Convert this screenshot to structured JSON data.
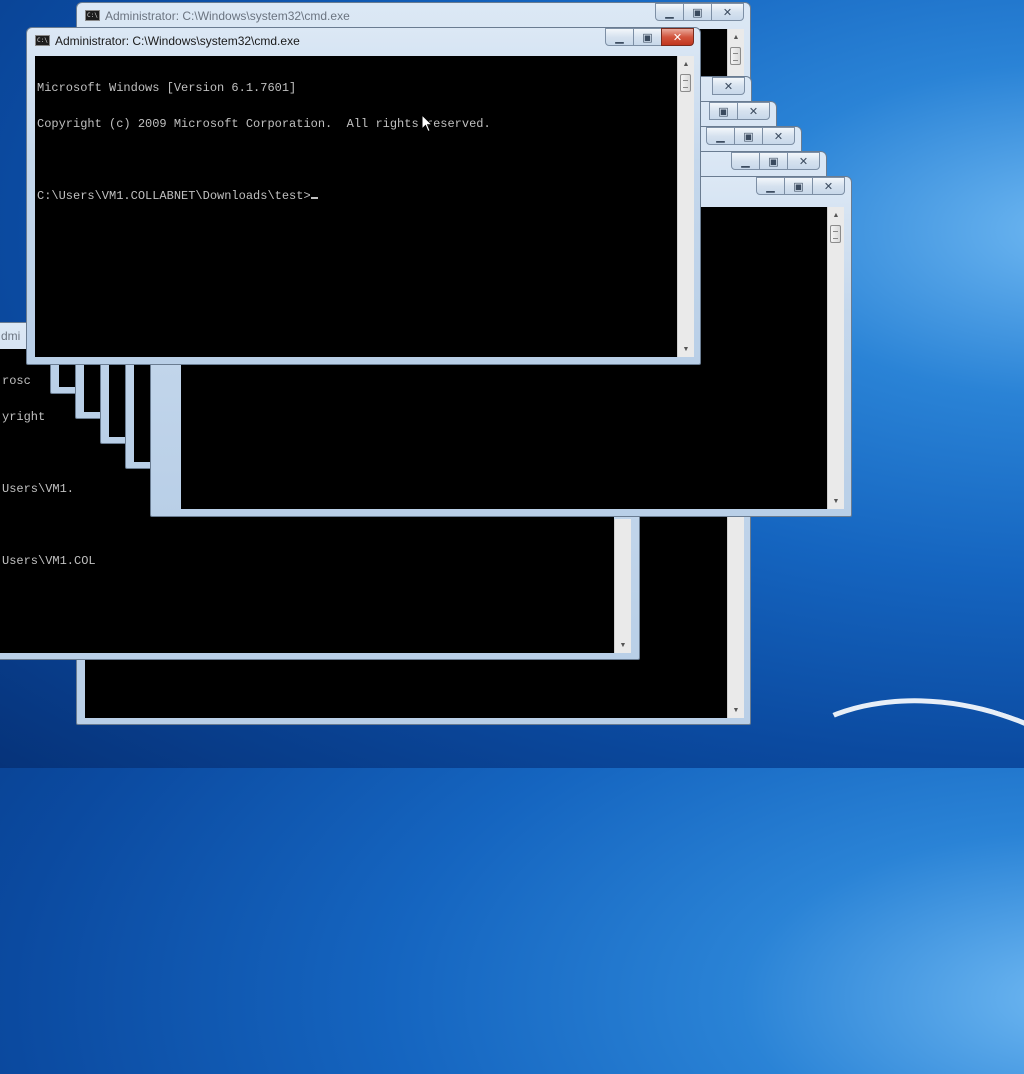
{
  "desktop": {
    "accent": "#1565c0"
  },
  "windows": {
    "back_large": {
      "title": "Administrator: C:\\Windows\\system32\\cmd.exe",
      "minimize": "▁",
      "maximize": "▣",
      "close": "✕"
    },
    "left_partial": {
      "title_fragment": "dmi",
      "lines": [
        "rosc",
        "yright",
        "",
        "Users\\VM1.",
        "",
        "Users\\VM1.COL"
      ]
    },
    "cascade_controls": {
      "minimize": "▁",
      "maximize": "▣",
      "close": "✕"
    },
    "front": {
      "title": "Administrator: C:\\Windows\\system32\\cmd.exe",
      "minimize": "▁",
      "maximize": "▣",
      "close": "✕",
      "line1": "Microsoft Windows [Version 6.1.7601]",
      "line2": "Copyright (c) 2009 Microsoft Corporation.  All rights reserved.",
      "line3": "",
      "prompt": "C:\\Users\\VM1.COLLABNET\\Downloads\\test>"
    }
  },
  "scrollbar": {
    "up_arrow": "▲",
    "down_arrow": "▼"
  },
  "pointer": {
    "icon": "mouse-pointer-icon"
  }
}
